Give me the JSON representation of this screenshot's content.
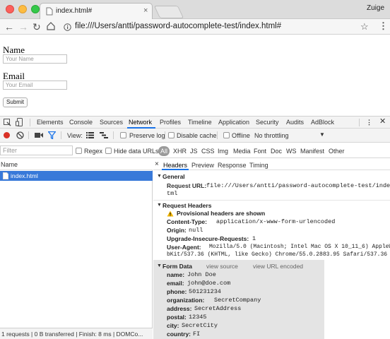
{
  "browser": {
    "profile": "Zuige",
    "tab_title": "index.html#",
    "url": "file:///Users/antti/password-autocomplete-test/index.html#"
  },
  "page": {
    "name_label": "Name",
    "name_placeholder": "Your Name",
    "email_label": "Email",
    "email_placeholder": "Your Email",
    "submit_label": "Submit"
  },
  "devtools": {
    "panels": [
      "Elements",
      "Console",
      "Sources",
      "Network",
      "Profiles",
      "Timeline",
      "Application",
      "Security",
      "Audits",
      "AdBlock"
    ],
    "active_panel": "Network",
    "toolbar": {
      "view_label": "View:",
      "preserve_log": "Preserve log",
      "disable_cache": "Disable cache",
      "offline": "Offline",
      "throttling": "No throttling"
    },
    "filter": {
      "placeholder": "Filter",
      "regex": "Regex",
      "hide_data_urls": "Hide data URLs",
      "types": [
        "All",
        "XHR",
        "JS",
        "CSS",
        "Img",
        "Media",
        "Font",
        "Doc",
        "WS",
        "Manifest",
        "Other"
      ]
    },
    "request_list": {
      "header": "Name",
      "items": [
        "index.html"
      ]
    },
    "status": "1 requests | 0 B transferred | Finish: 8 ms | DOMCo...",
    "detail_tabs": [
      "Headers",
      "Preview",
      "Response",
      "Timing"
    ],
    "general": {
      "title": "General",
      "request_url_label": "Request URL:",
      "request_url_line1": "file:///Users/antti/password-autocomplete-test/index.h",
      "request_url_line2": "tml"
    },
    "request_headers": {
      "title": "Request Headers",
      "warning": "Provisional headers are shown",
      "rows": [
        {
          "name": "Content-Type:",
          "value": "application/x-www-form-urlencoded"
        },
        {
          "name": "Origin:",
          "value": "null"
        },
        {
          "name": "Upgrade-Insecure-Requests:",
          "value": "1"
        },
        {
          "name": "User-Agent:",
          "value": "Mozilla/5.0 (Macintosh; Intel Mac OS X 10_11_6) AppleWe"
        }
      ],
      "user_agent_line2": "bKit/537.36 (KHTML, like Gecko) Chrome/55.0.2883.95 Safari/537.36"
    },
    "form_data": {
      "title": "Form Data",
      "view_source": "view source",
      "view_url_encoded": "view URL encoded",
      "rows": [
        {
          "name": "name:",
          "value": "John Doe"
        },
        {
          "name": "email:",
          "value": "john@doe.com"
        },
        {
          "name": "phone:",
          "value": "501231234"
        },
        {
          "name": "organization:",
          "value": "SecretCompany"
        },
        {
          "name": "address:",
          "value": "SecretAddress"
        },
        {
          "name": "postal:",
          "value": "12345"
        },
        {
          "name": "city:",
          "value": "SecretCity"
        },
        {
          "name": "country:",
          "value": "FI"
        }
      ]
    }
  },
  "colors": {
    "accent_blue": "#1a73e8",
    "selected_row": "#3879d9",
    "record_red": "#d93025",
    "warning_yellow": "#f2b600"
  }
}
